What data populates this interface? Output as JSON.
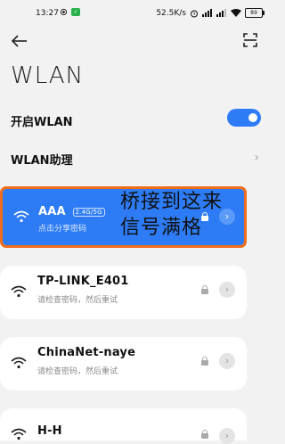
{
  "status_bar": {
    "time": "13:27",
    "speed": "52.5K/s",
    "battery": "89"
  },
  "page": {
    "title": "WLAN"
  },
  "settings": {
    "enable_label": "开启WLAN",
    "enable_on": true,
    "assistant_label": "WLAN助理"
  },
  "networks": [
    {
      "name": "AAA",
      "band": "2.4G/5G",
      "subtitle": "点击分享密码",
      "connected": true,
      "annotation_line1": "桥接到这来",
      "annotation_line2": "信号满格"
    },
    {
      "name": "TP-LINK_E401",
      "subtitle": "请检查密码，然后重试"
    },
    {
      "name": "ChinaNet-naye",
      "subtitle": "请检查密码，然后重试"
    },
    {
      "name": "H-H",
      "subtitle": ""
    }
  ],
  "colors": {
    "accent": "#2d7cf6",
    "annotation_border": "#ef6c1a",
    "background": "#f2f2f2"
  },
  "icons": [
    "back-arrow-icon",
    "scan-icon",
    "wifi-icon",
    "lock-icon",
    "chevron-right-icon"
  ]
}
